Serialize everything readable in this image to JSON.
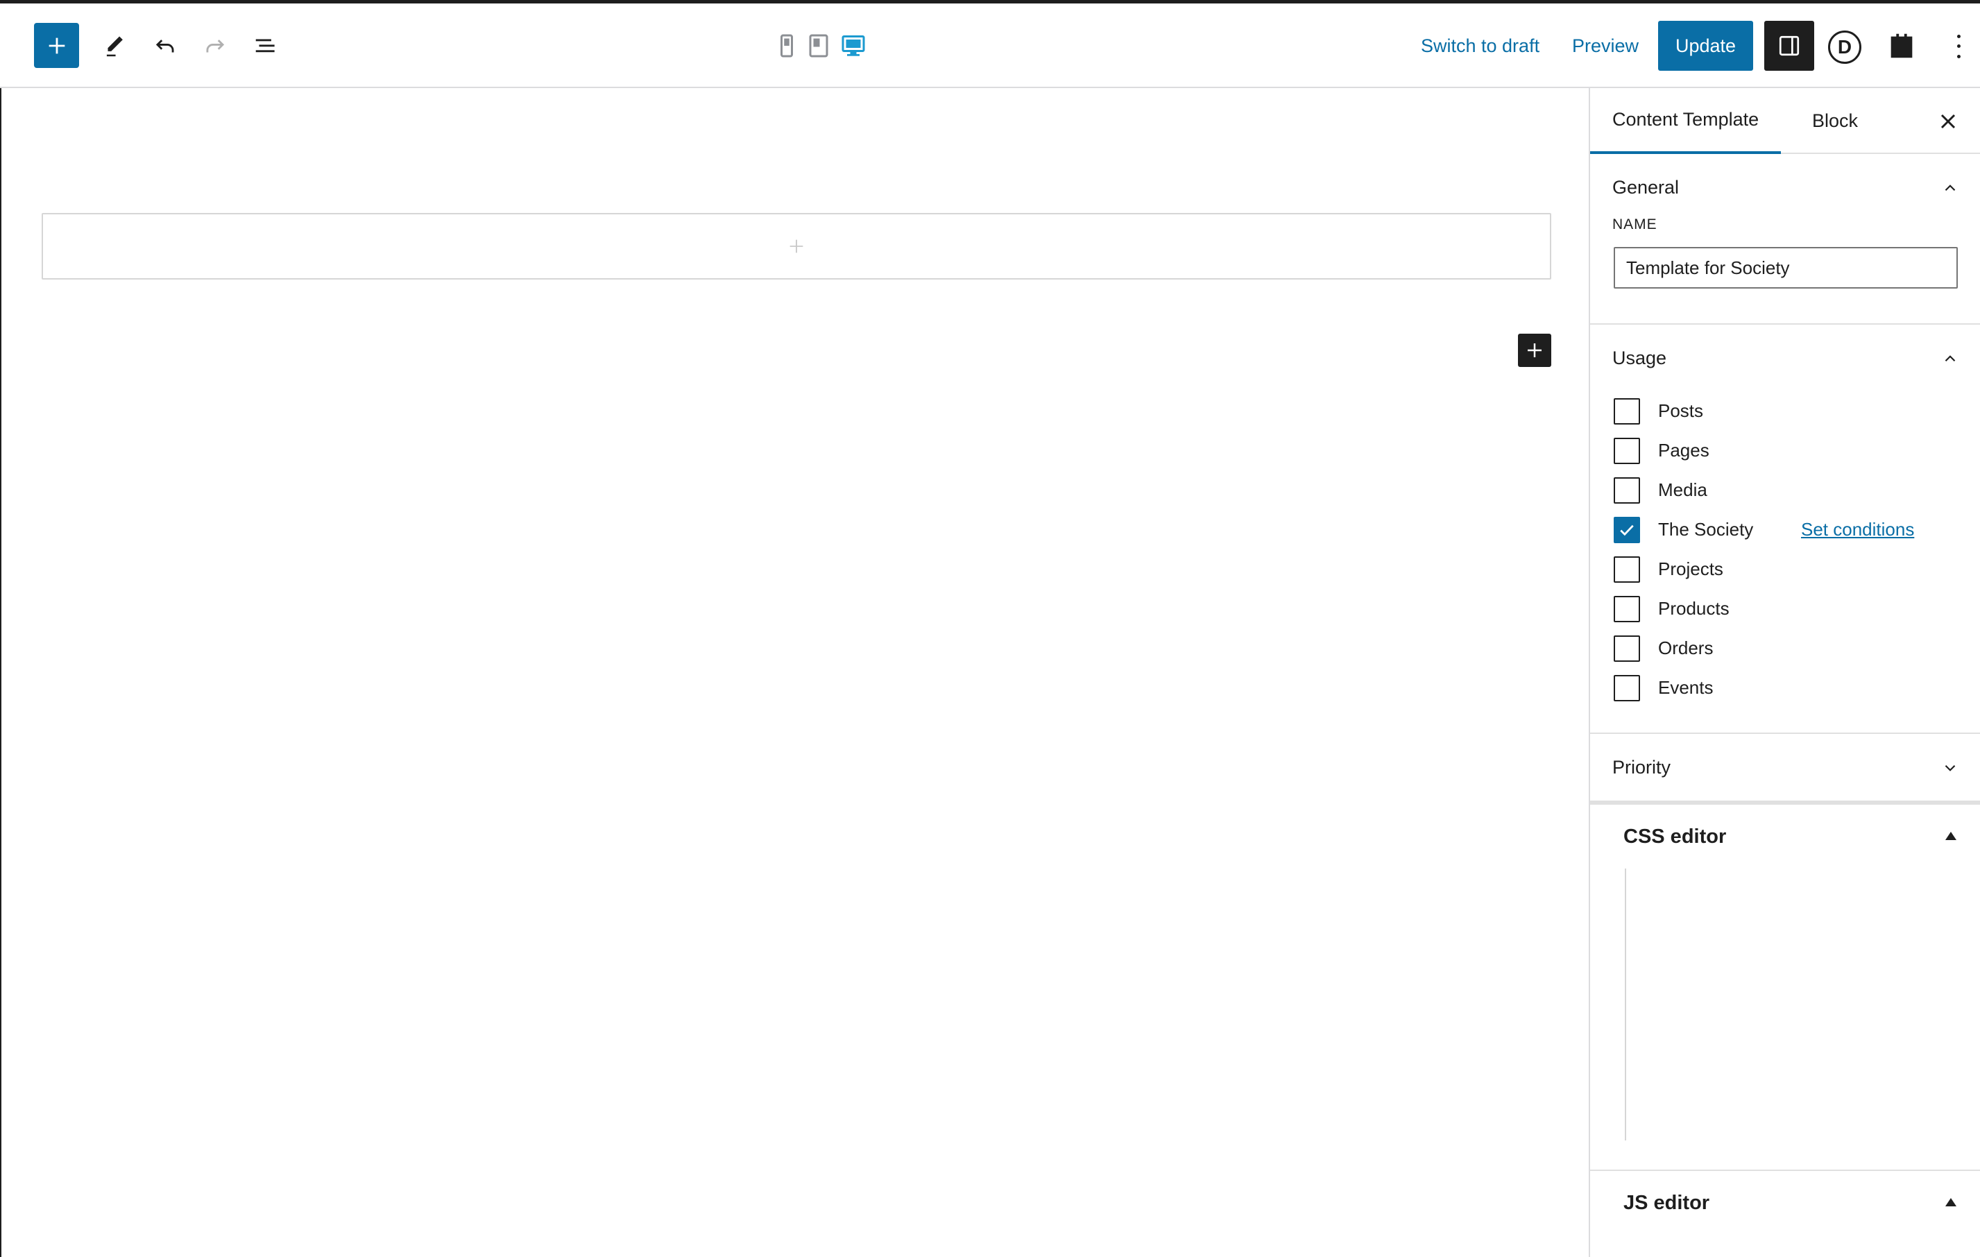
{
  "header": {
    "switch_to_draft": "Switch to draft",
    "preview": "Preview",
    "update": "Update",
    "logo_letter": "D"
  },
  "sidebar": {
    "tabs": [
      "Content Template",
      "Block"
    ],
    "general": {
      "title": "General",
      "name_label": "NAME",
      "name_value": "Template for Society"
    },
    "usage": {
      "title": "Usage",
      "items": [
        {
          "label": "Posts",
          "checked": false
        },
        {
          "label": "Pages",
          "checked": false
        },
        {
          "label": "Media",
          "checked": false
        },
        {
          "label": "The Society",
          "checked": true
        },
        {
          "label": "Projects",
          "checked": false
        },
        {
          "label": "Products",
          "checked": false
        },
        {
          "label": "Orders",
          "checked": false
        },
        {
          "label": "Events",
          "checked": false
        }
      ],
      "set_conditions": "Set conditions"
    },
    "priority": {
      "title": "Priority"
    },
    "css_editor": {
      "title": "CSS editor"
    },
    "js_editor": {
      "title": "JS editor"
    }
  },
  "colors": {
    "accent": "#0a6ea6",
    "dark": "#1e1e1e",
    "border": "#e0e0e0"
  }
}
